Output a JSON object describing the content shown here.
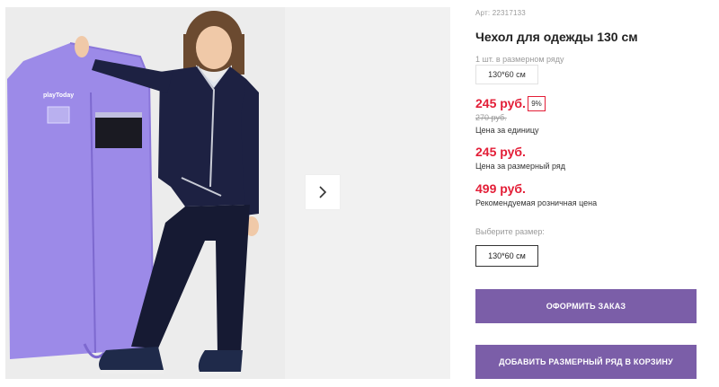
{
  "product": {
    "article_label": "Арт: 22317133",
    "title": "Чехол для одежды 130 см",
    "pack_label": "1 шт. в размерном ряду",
    "pack_size": "130*60 см",
    "price_unit": "245 руб.",
    "discount": "9%",
    "old_price": "270 руб.",
    "unit_label": "Цена за единицу",
    "price_range": "245 руб.",
    "range_label": "Цена за размерный ряд",
    "price_retail": "499 руб.",
    "retail_label": "Рекомендуемая розничная цена",
    "choose_size_label": "Выберите размер:",
    "selected_size": "130*60 см"
  },
  "bag_logo": "playToday",
  "buttons": {
    "order": "ОФОРМИТЬ ЗАКАЗ",
    "add_to_cart": "ДОБАВИТЬ РАЗМЕРНЫЙ РЯД В КОРЗИНУ"
  },
  "colors": {
    "accent": "#7b5ea8",
    "price": "#e31e37",
    "bag": "#9c8ae8"
  }
}
